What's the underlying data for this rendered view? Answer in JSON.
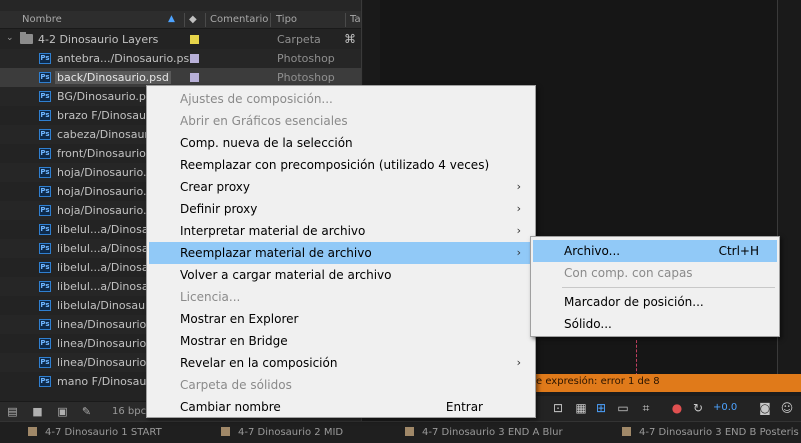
{
  "project_panel": {
    "columns": {
      "name": "Nombre",
      "comment": "Comentario",
      "type": "Tipo",
      "extra": "Ta"
    },
    "rows": [
      {
        "name": "4-2 Dinosaurio Layers",
        "type": "Carpeta",
        "kind": "folder",
        "label_color": "#e6d44a"
      },
      {
        "name": "antebra.../Dinosaurio.psd",
        "type": "Photoshop",
        "kind": "psd"
      },
      {
        "name": "back/Dinosaurio.psd",
        "type": "Photoshop",
        "kind": "psd",
        "selected": true
      },
      {
        "name": "BG/Dinosaurio.psd",
        "type": "",
        "kind": "psd"
      },
      {
        "name": "brazo F/Dinosaur",
        "type": "",
        "kind": "psd"
      },
      {
        "name": "cabeza/Dinosaur",
        "type": "",
        "kind": "psd"
      },
      {
        "name": "front/Dinosaurio.",
        "type": "",
        "kind": "psd"
      },
      {
        "name": "hoja/Dinosaurio.p",
        "type": "",
        "kind": "psd"
      },
      {
        "name": "hoja/Dinosaurio.p",
        "type": "",
        "kind": "psd"
      },
      {
        "name": "hoja/Dinosaurio.p",
        "type": "",
        "kind": "psd"
      },
      {
        "name": "libelul...a/Dinosau",
        "type": "",
        "kind": "psd"
      },
      {
        "name": "libelul...a/Dinosau",
        "type": "",
        "kind": "psd"
      },
      {
        "name": "libelul...a/Dinosau",
        "type": "",
        "kind": "psd"
      },
      {
        "name": "libelul...a/Dinosau",
        "type": "",
        "kind": "psd"
      },
      {
        "name": "libelula/Dinosaur",
        "type": "",
        "kind": "psd"
      },
      {
        "name": "linea/Dinosaurio.",
        "type": "",
        "kind": "psd"
      },
      {
        "name": "linea/Dinosaurio.",
        "type": "",
        "kind": "psd"
      },
      {
        "name": "linea/Dinosaurio.",
        "type": "",
        "kind": "psd"
      },
      {
        "name": "mano F/Dinosaur",
        "type": "",
        "kind": "psd"
      }
    ],
    "ps_badge": "Ps",
    "footer": {
      "bpc": "16 bpc"
    }
  },
  "context_menu": {
    "items": [
      {
        "label": "Ajustes de composición...",
        "disabled": true
      },
      {
        "label": "Abrir en Gráficos esenciales",
        "disabled": true
      },
      {
        "label": "Comp. nueva de la selección"
      },
      {
        "label": "Reemplazar con precomposición (utilizado 4 veces)"
      },
      {
        "label": "Crear proxy",
        "submenu": true
      },
      {
        "label": "Definir proxy",
        "submenu": true
      },
      {
        "label": "Interpretar material de archivo",
        "submenu": true
      },
      {
        "label": "Reemplazar material de archivo",
        "submenu": true,
        "active": true
      },
      {
        "label": "Volver a cargar material de archivo"
      },
      {
        "label": "Licencia...",
        "disabled": true
      },
      {
        "label": "Mostrar en Explorer"
      },
      {
        "label": "Mostrar en Bridge"
      },
      {
        "label": "Revelar en la composición",
        "submenu": true
      },
      {
        "label": "Carpeta de sólidos",
        "disabled": true
      },
      {
        "label": "Cambiar nombre",
        "accelerator": "Entrar"
      }
    ]
  },
  "submenu": {
    "items": [
      {
        "label": "Archivo...",
        "accelerator": "Ctrl+H",
        "active": true
      },
      {
        "label": "Con comp. con capas",
        "disabled": true
      },
      {
        "separator": true
      },
      {
        "label": "Marcador de posición..."
      },
      {
        "label": "Sólido..."
      }
    ]
  },
  "viewer": {
    "error_text": "e expresión: error 1 de 8",
    "exposure_value": "+0.0"
  },
  "tabs": [
    {
      "label": "4-7 Dinosaurio 1 START"
    },
    {
      "label": "4-7 Dinosaurio 2 MID"
    },
    {
      "label": "4-7 Dinosaurio 3 END A Blur"
    },
    {
      "label": "4-7 Dinosaurio 3 END B Posteris"
    }
  ],
  "colors": {
    "menu_highlight": "#91c9f7",
    "error_bar": "#e07a1a",
    "ps_icon": "#2f7fd0"
  }
}
